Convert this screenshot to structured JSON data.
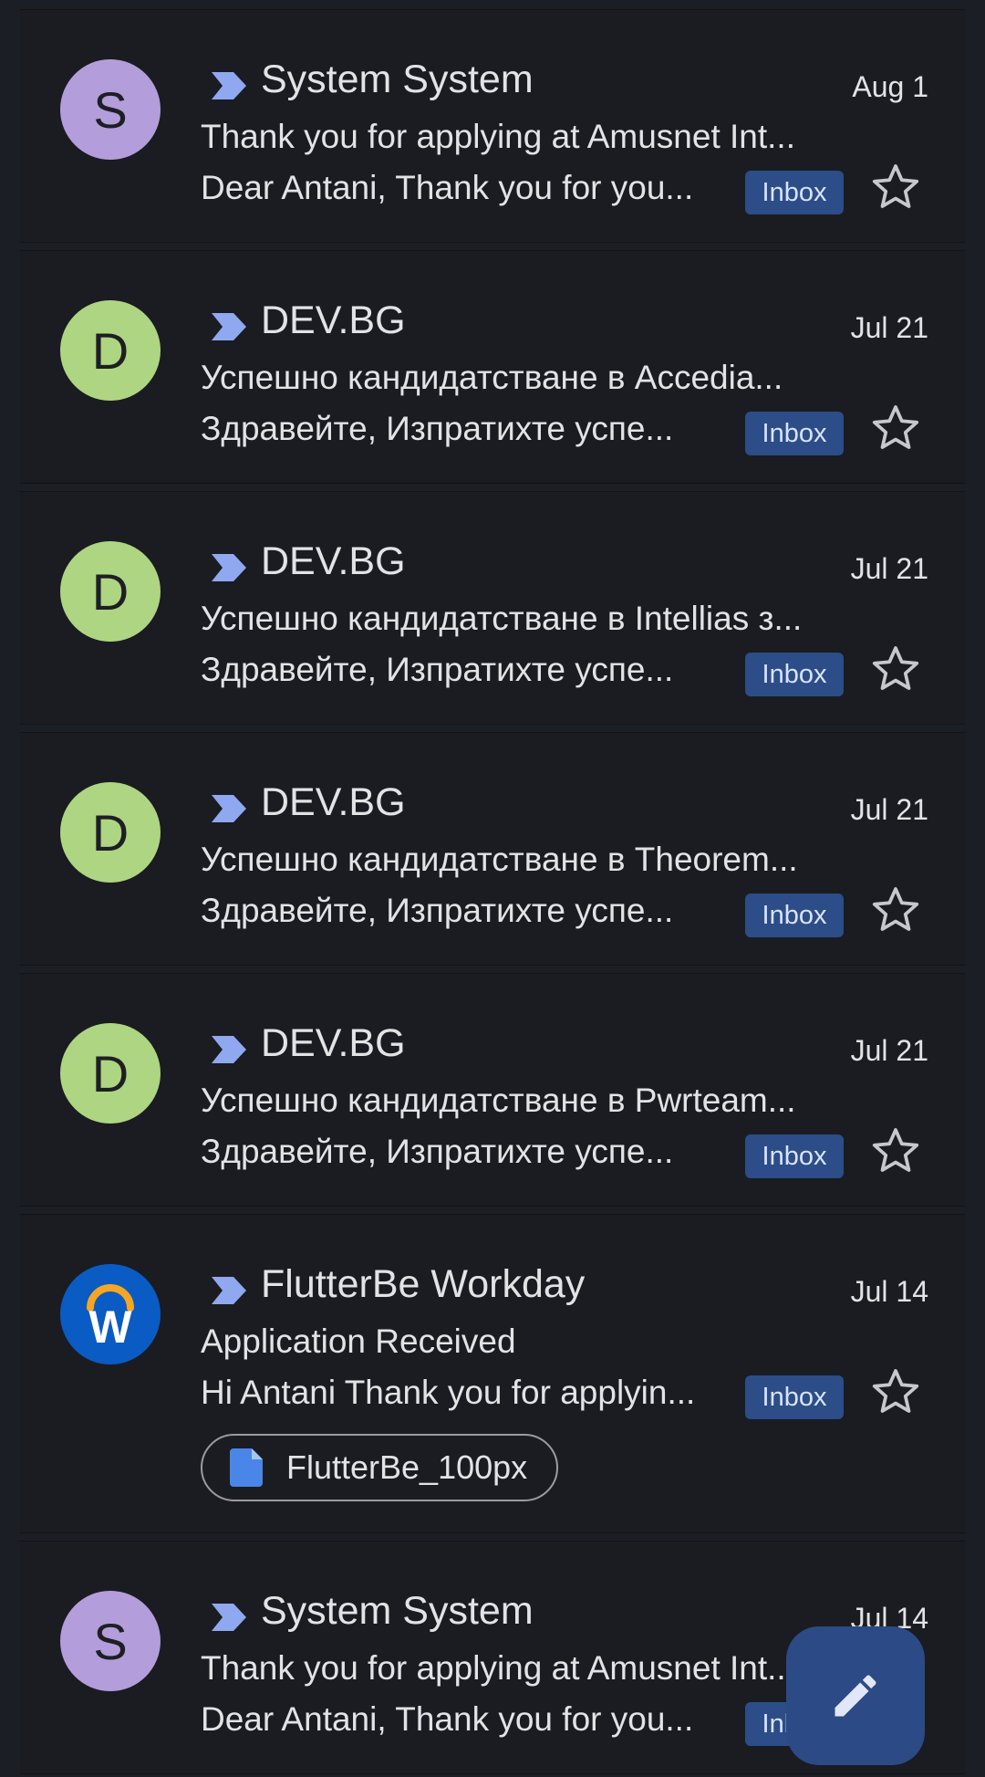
{
  "emails": [
    {
      "avatar_letter": "S",
      "avatar_color": "#b39ddb",
      "sender": "System System",
      "date": "Aug 1",
      "subject": "Thank you for applying at Amusnet Int...",
      "snippet": "Dear Antani, Thank you for you...",
      "label": "Inbox"
    },
    {
      "avatar_letter": "D",
      "avatar_color": "#aed581",
      "sender": "DEV.BG",
      "date": "Jul 21",
      "subject": "Успешно кандидатстване в Accedia...",
      "snippet": "Здравейте, Изпратихте успе...",
      "label": "Inbox"
    },
    {
      "avatar_letter": "D",
      "avatar_color": "#aed581",
      "sender": "DEV.BG",
      "date": "Jul 21",
      "subject": "Успешно кандидатстване в Intellias з...",
      "snippet": "Здравейте, Изпратихте успе...",
      "label": "Inbox"
    },
    {
      "avatar_letter": "D",
      "avatar_color": "#aed581",
      "sender": "DEV.BG",
      "date": "Jul 21",
      "subject": "Успешно кандидатстване в Theorem...",
      "snippet": "Здравейте, Изпратихте успе...",
      "label": "Inbox"
    },
    {
      "avatar_letter": "D",
      "avatar_color": "#aed581",
      "sender": "DEV.BG",
      "date": "Jul 21",
      "subject": "Успешно кандидатстване в Pwrteam...",
      "snippet": "Здравейте, Изпратихте успе...",
      "label": "Inbox"
    },
    {
      "avatar_letter": "W",
      "avatar_color": "#0a5bc4",
      "sender": "FlutterBe Workday",
      "date": "Jul 14",
      "subject": "Application Received",
      "snippet": "Hi Antani Thank you for applyin...",
      "label": "Inbox",
      "attachment": "FlutterBe_100px"
    },
    {
      "avatar_letter": "S",
      "avatar_color": "#b39ddb",
      "sender": "System System",
      "date": "Jul 14",
      "subject": "Thank you for applying at Amusnet Int...",
      "snippet": "Dear Antani, Thank you for you...",
      "label": "Inbox"
    }
  ],
  "colors": {
    "importance_marker": "#8fa8ef",
    "label_bg": "#2c4d87",
    "fab_bg": "#2c4a85"
  },
  "icons": {
    "importance": "importance-marker-icon",
    "star": "star-outline-icon",
    "attachment": "doc-file-icon",
    "compose": "pencil-icon"
  }
}
